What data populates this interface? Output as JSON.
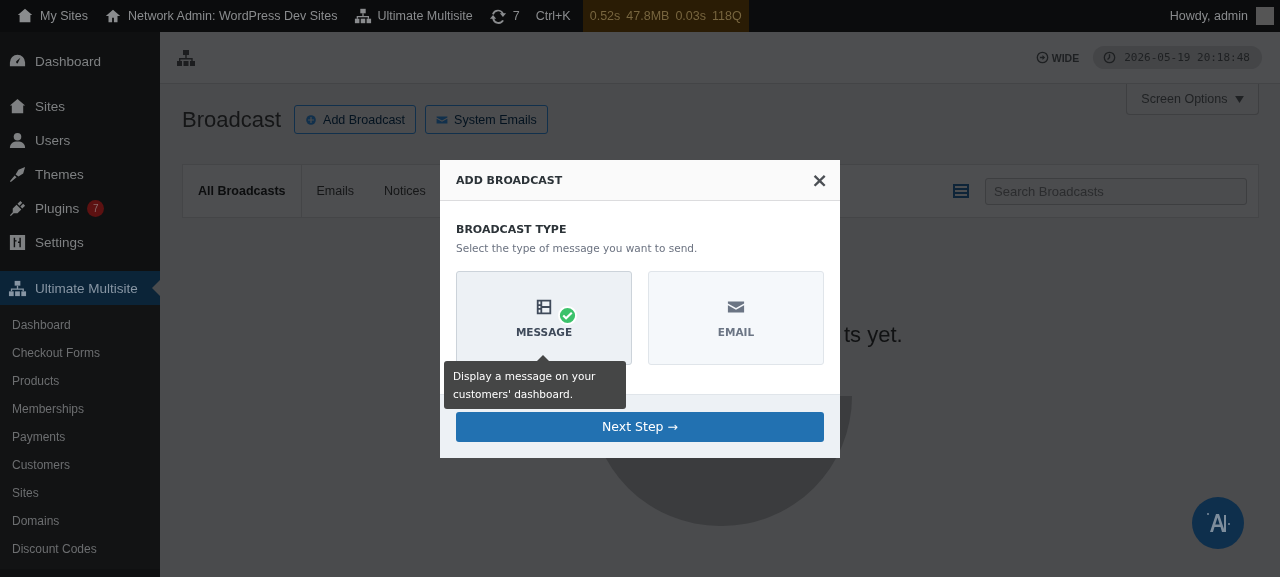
{
  "admin_bar": {
    "items": [
      {
        "kind": "sites",
        "label": "My Sites"
      },
      {
        "kind": "home",
        "label": "Network Admin: WordPress Dev Sites"
      },
      {
        "kind": "network",
        "label": "Ultimate Multisite"
      },
      {
        "kind": "updates",
        "label": "7"
      },
      {
        "kind": "shortcut",
        "label": "Ctrl+K"
      }
    ],
    "perf": [
      "0.52s",
      "47.8MB",
      "0.03s",
      "118Q"
    ],
    "greeting": "Howdy, admin"
  },
  "sidebar": {
    "items": [
      {
        "kind": "dashboard",
        "label": "Dashboard",
        "selected": false
      },
      {
        "kind": "sites",
        "label": "Sites",
        "selected": false
      },
      {
        "kind": "users",
        "label": "Users",
        "selected": false
      },
      {
        "kind": "themes",
        "label": "Themes",
        "selected": false
      },
      {
        "kind": "plugins",
        "label": "Plugins",
        "selected": false,
        "badge": "7"
      },
      {
        "kind": "settings",
        "label": "Settings",
        "selected": false
      },
      {
        "kind": "network",
        "label": "Ultimate Multisite",
        "selected": true
      }
    ],
    "submenu": [
      "Dashboard",
      "Checkout Forms",
      "Products",
      "Memberships",
      "Payments",
      "Customers",
      "Sites",
      "Domains",
      "Discount Codes"
    ]
  },
  "top_bar": {
    "wide": "WIDE",
    "clock": "2026-05-19 20:18:48"
  },
  "screen_options": "Screen Options",
  "page": {
    "title": "Broadcast",
    "buttons": [
      {
        "kind": "add",
        "label": "Add Broadcast"
      },
      {
        "kind": "email",
        "label": "System Emails"
      }
    ]
  },
  "tabs": [
    {
      "label": "All Broadcasts",
      "selected": true
    },
    {
      "label": "Emails",
      "selected": false
    },
    {
      "label": "Notices",
      "selected": false
    }
  ],
  "search": {
    "placeholder": "Search Broadcasts"
  },
  "empty_text": "ts yet.",
  "modal": {
    "title": "ADD BROADCAST",
    "close": "×",
    "heading": "BROADCAST TYPE",
    "description": "Select the type of message you want to send.",
    "types": [
      {
        "kind": "message",
        "label": "MESSAGE",
        "selected": true
      },
      {
        "kind": "email",
        "label": "EMAIL",
        "selected": false
      }
    ],
    "tooltip": "Display a message on your customers' dashboard.",
    "next": "Next Step →"
  }
}
